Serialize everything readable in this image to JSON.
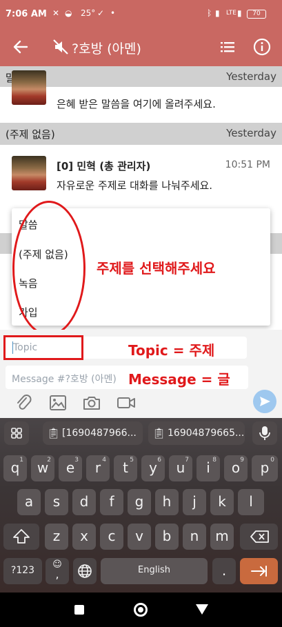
{
  "status_bar": {
    "time": "7:06 AM",
    "temp": "25°",
    "battery": "70",
    "network": "LTE"
  },
  "app_bar": {
    "title": "?호방 (아멘)",
    "icons": [
      "back-arrow-icon",
      "muted-speaker-icon",
      "list-icon",
      "info-icon"
    ]
  },
  "sections": [
    {
      "label": "말씀",
      "date": "Yesterday"
    },
    {
      "label": "(주제 없음)",
      "date": "Yesterday"
    }
  ],
  "messages": [
    {
      "text": "은혜 받은 말씀을 여기에 올려주세요."
    },
    {
      "author": "[0] 민혁 (총 관리자)",
      "time": "10:51 PM",
      "text": "자유로운 주제로 대화를 나눠주세요."
    }
  ],
  "topic_dropdown": {
    "items": [
      "말씀",
      "(주제 없음)",
      "녹음",
      "가입"
    ]
  },
  "annotations": {
    "select_topic": "주제를 선택해주세요",
    "topic_eq": "Topic = 주제",
    "message_eq": "Message = 글",
    "color": "#e0191b"
  },
  "compose": {
    "topic_placeholder": "Topic",
    "message_placeholder": "Message #?호방 (아멘)"
  },
  "keyboard": {
    "clipboard": [
      "[1690487966...",
      "16904879665..."
    ],
    "row1": [
      "q",
      "w",
      "e",
      "r",
      "t",
      "y",
      "u",
      "i",
      "o",
      "p"
    ],
    "row1_hints": [
      "1",
      "2",
      "3",
      "4",
      "5",
      "6",
      "7",
      "8",
      "9",
      "0"
    ],
    "row2": [
      "a",
      "s",
      "d",
      "f",
      "g",
      "h",
      "j",
      "k",
      "l"
    ],
    "row3": [
      "z",
      "x",
      "c",
      "v",
      "b",
      "n",
      "m"
    ],
    "symbols": "?123",
    "space": "English",
    "period": "."
  },
  "colors": {
    "header": "#c96862",
    "section_bar": "#d0d0d0",
    "send": "#9ec8ef",
    "enter_key": "#c96a3e"
  }
}
